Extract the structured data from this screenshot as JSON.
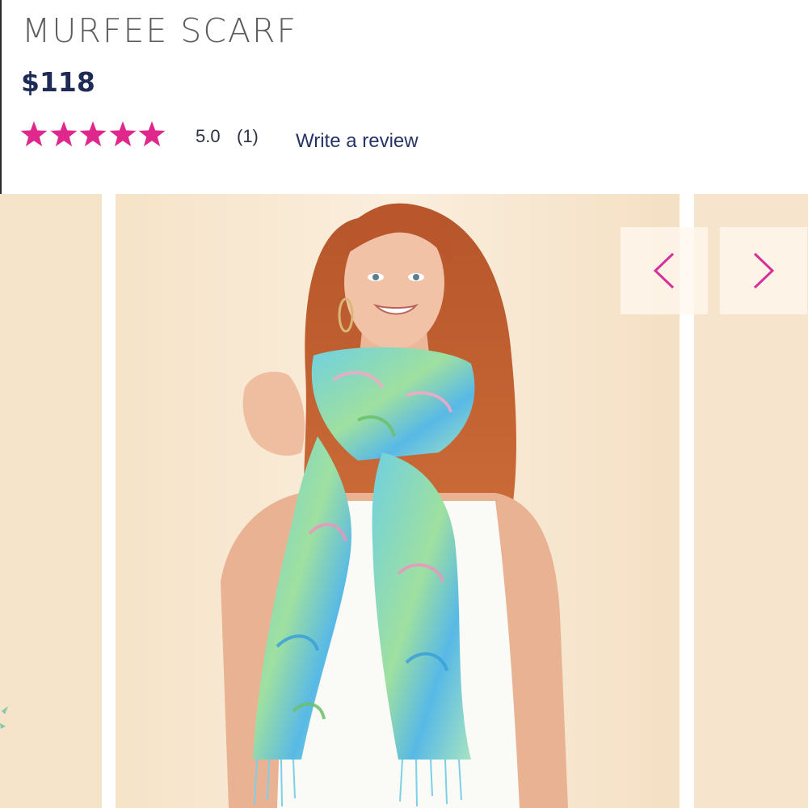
{
  "product": {
    "title": "MURFEE SCARF",
    "price": "$118"
  },
  "rating": {
    "stars": 5,
    "max_stars": 5,
    "value": "5.0",
    "count": "(1)",
    "write_review_label": "Write a review",
    "star_icon": "star-icon"
  },
  "gallery": {
    "prev_icon": "chevron-left-icon",
    "next_icon": "chevron-right-icon"
  },
  "colors": {
    "title": "#5c5c5c",
    "price": "#1f2b57",
    "star": "#e0278c",
    "chevron": "#d6309b",
    "link": "#243467",
    "background": "#f7e6cf"
  }
}
